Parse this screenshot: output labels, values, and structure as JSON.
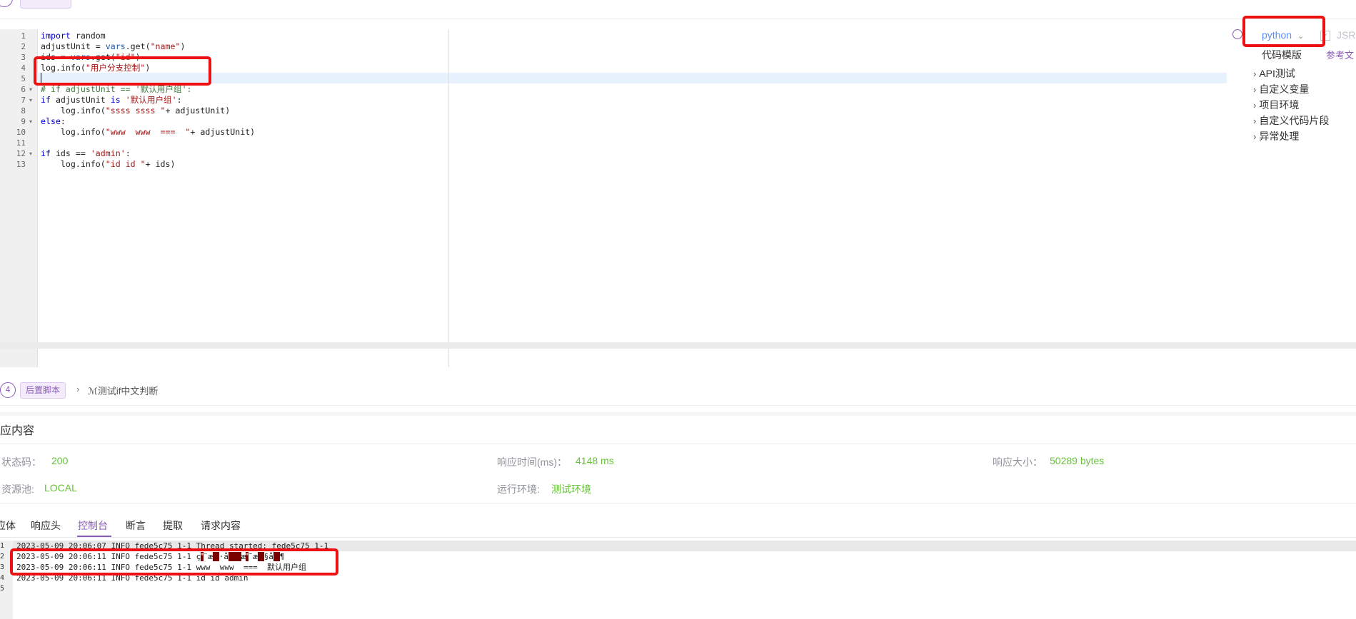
{
  "editor": {
    "line_numbers": [
      "1",
      "2",
      "3",
      "4",
      "5",
      "6",
      "7",
      "8",
      "9",
      "10",
      "11",
      "12",
      "13"
    ],
    "lines": [
      {
        "segments": [
          {
            "t": "import",
            "c": "kw"
          },
          {
            "t": " random",
            "c": ""
          }
        ]
      },
      {
        "segments": [
          {
            "t": "adjustUnit = ",
            "c": ""
          },
          {
            "t": "vars",
            "c": "var"
          },
          {
            "t": ".get(",
            "c": ""
          },
          {
            "t": "\"name\"",
            "c": "str"
          },
          {
            "t": ")",
            "c": ""
          }
        ]
      },
      {
        "segments": [
          {
            "t": "ids = ",
            "c": ""
          },
          {
            "t": "vars",
            "c": "var"
          },
          {
            "t": ".get(",
            "c": ""
          },
          {
            "t": "\"id\"",
            "c": "str"
          },
          {
            "t": ")",
            "c": ""
          }
        ]
      },
      {
        "segments": [
          {
            "t": "log.info(",
            "c": ""
          },
          {
            "t": "\"用户分支控制\"",
            "c": "str"
          },
          {
            "t": ")",
            "c": ""
          }
        ]
      },
      {
        "segments": []
      },
      {
        "segments": [
          {
            "t": "# if adjustUnit == '默认用户组':",
            "c": "cmt"
          }
        ]
      },
      {
        "segments": [
          {
            "t": "if",
            "c": "kw"
          },
          {
            "t": " adjustUnit ",
            "c": ""
          },
          {
            "t": "is",
            "c": "kw"
          },
          {
            "t": " ",
            "c": ""
          },
          {
            "t": "'默认用户组'",
            "c": "str"
          },
          {
            "t": ":",
            "c": ""
          }
        ]
      },
      {
        "segments": [
          {
            "t": "    log.info(",
            "c": ""
          },
          {
            "t": "\"ssss ssss \"",
            "c": "str"
          },
          {
            "t": "+ adjustUnit)",
            "c": ""
          }
        ]
      },
      {
        "segments": [
          {
            "t": "else",
            "c": "kw"
          },
          {
            "t": ":",
            "c": ""
          }
        ]
      },
      {
        "segments": [
          {
            "t": "    log.info(",
            "c": ""
          },
          {
            "t": "\"www  www  ===  \"",
            "c": "str"
          },
          {
            "t": "+ adjustUnit)",
            "c": ""
          }
        ]
      },
      {
        "segments": []
      },
      {
        "segments": [
          {
            "t": "if",
            "c": "kw"
          },
          {
            "t": " ids == ",
            "c": ""
          },
          {
            "t": "'admin'",
            "c": "str"
          },
          {
            "t": ":",
            "c": ""
          }
        ]
      },
      {
        "segments": [
          {
            "t": "    log.info(",
            "c": ""
          },
          {
            "t": "\"id id \"",
            "c": "str"
          },
          {
            "t": "+ ids)",
            "c": ""
          }
        ]
      }
    ]
  },
  "side_panel": {
    "language": "python",
    "jsr_label": "JSR",
    "template_label": "代码模版",
    "reference_label": "参考文",
    "tree": [
      "API测试",
      "自定义变量",
      "项目环境",
      "自定义代码片段",
      "异常处理"
    ]
  },
  "post_script": {
    "step_number": "4",
    "tag": "后置脚本",
    "name": "测试if中文判断"
  },
  "response": {
    "title": "应内容",
    "status_label": "状态码：",
    "status_value": "200",
    "time_label": "响应时间(ms)：",
    "time_value": "4148 ms",
    "size_label": "响应大小：",
    "size_value": "50289 bytes",
    "pool_label": "资源池:",
    "pool_value": "LOCAL",
    "env_label": "运行环境:",
    "env_value": "测试环境"
  },
  "tabs": [
    "应体",
    "响应头",
    "控制台",
    "断言",
    "提取",
    "请求内容"
  ],
  "active_tab": "控制台",
  "console": {
    "line_numbers": [
      "1",
      "2",
      "3",
      "4",
      "5"
    ],
    "lines": [
      {
        "segments": [
          {
            "t": "2023-05-09 20:06:07 INFO fede5c75 1-1 Thread started: fede5c75 1-1",
            "g": false
          }
        ]
      },
      {
        "segments": [
          {
            "t": "2023-05-09 20:06:11 INFO fede5c75 1-1 ç",
            "g": false
          },
          {
            "t": "",
            "g": true
          },
          {
            "t": "¨æ",
            "g": false
          },
          {
            "t": "",
            "g": true
          },
          {
            "t": "·å",
            "g": false
          },
          {
            "t": "",
            "g": true
          },
          {
            "t": "",
            "g": true
          },
          {
            "t": "æ",
            "g": false
          },
          {
            "t": "",
            "g": true
          },
          {
            "t": "¯æ",
            "g": false
          },
          {
            "t": "",
            "g": true
          },
          {
            "t": "§å",
            "g": false
          },
          {
            "t": "",
            "g": true
          },
          {
            "t": "¶",
            "g": false
          }
        ]
      },
      {
        "segments": [
          {
            "t": "2023-05-09 20:06:11 INFO fede5c75 1-1 www  www  ===  默认用户组",
            "g": false
          }
        ]
      },
      {
        "segments": [
          {
            "t": "2023-05-09 20:06:11 INFO fede5c75 1-1 id id admin",
            "g": false
          }
        ]
      },
      {
        "segments": []
      }
    ]
  }
}
